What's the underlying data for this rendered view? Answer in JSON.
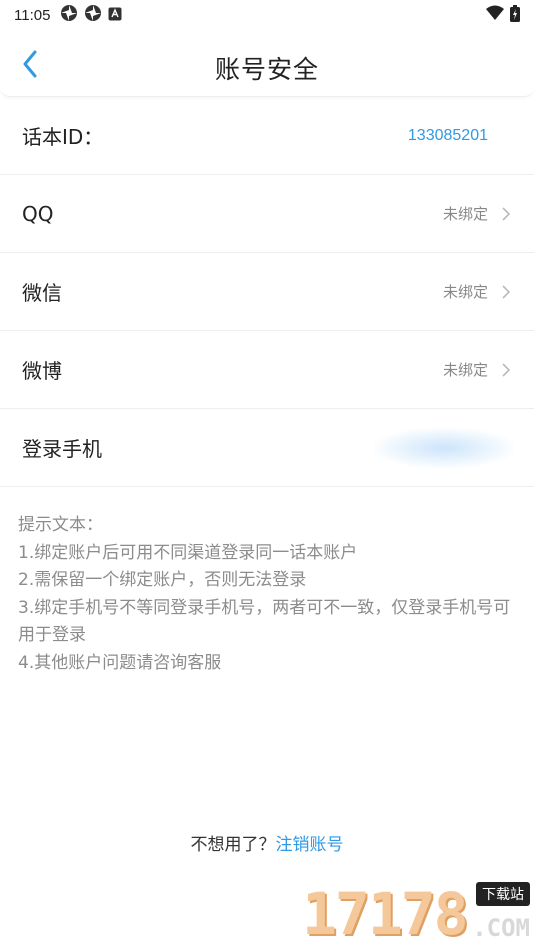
{
  "status_bar": {
    "time": "11:05",
    "left_icons": [
      "aperture-icon",
      "aperture-icon",
      "android-notification-icon"
    ],
    "right_icons": [
      "wifi-icon",
      "battery-charging-icon"
    ]
  },
  "nav": {
    "title": "账号安全",
    "back_icon": "chevron-left-icon",
    "accent_color": "#2f9ae6"
  },
  "account": {
    "id_label": "话本ID：",
    "id_value": "133085201",
    "bindings": [
      {
        "label": "QQ",
        "status": "未绑定"
      },
      {
        "label": "微信",
        "status": "未绑定"
      },
      {
        "label": "微博",
        "status": "未绑定"
      }
    ],
    "phone_label": "登录手机"
  },
  "tips": {
    "heading": "提示文本：",
    "lines": [
      "1.绑定账户后可用不同渠道登录同一话本账户",
      "2.需保留一个绑定账户，否则无法登录",
      "3.绑定手机号不等同登录手机号，两者可不一致，仅登录手机号可用于登录",
      "4.其他账户问题请咨询客服"
    ]
  },
  "footer": {
    "prompt": "不想用了？",
    "link": "注销账号"
  },
  "watermark": {
    "digits": "17178",
    "tag": "下载站",
    "suffix": ".COM"
  }
}
